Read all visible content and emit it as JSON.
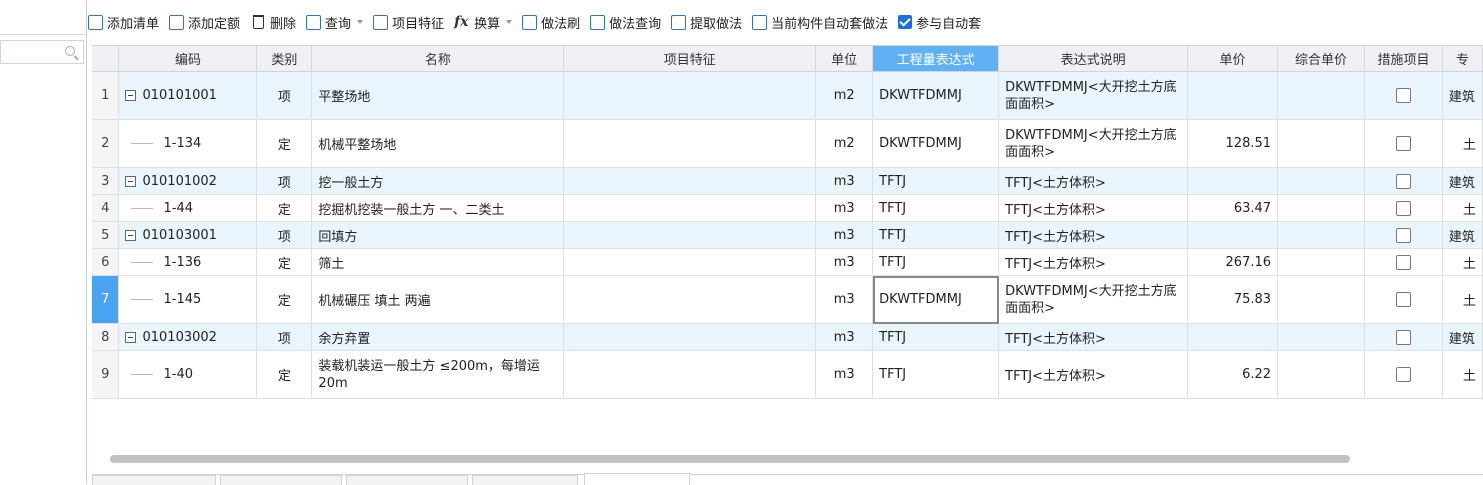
{
  "toolbar": {
    "add_list": "添加清单",
    "add_quota": "添加定额",
    "delete": "删除",
    "query": "查询",
    "item_feature": "项目特征",
    "convert": "换算",
    "method_brush": "做法刷",
    "method_query": "做法查询",
    "extract_method": "提取做法",
    "auto_apply": "当前构件自动套做法",
    "participate_auto": "参与自动套"
  },
  "columns": [
    "编码",
    "类别",
    "名称",
    "项目特征",
    "单位",
    "工程量表达式",
    "表达式说明",
    "单价",
    "综合单价",
    "措施项目",
    "专"
  ],
  "rows": [
    {
      "num": "1",
      "code": "010101001",
      "type": "项",
      "name": "平整场地",
      "feature": "",
      "unit": "m2",
      "expr": "DKWTFDMMJ",
      "desc": "DKWTFDMMJ<大开挖土方底面面积>",
      "price": "",
      "comp": "",
      "major": "建筑"
    },
    {
      "num": "2",
      "code": "1-134",
      "type": "定",
      "name": "机械平整场地",
      "feature": "",
      "unit": "m2",
      "expr": "DKWTFDMMJ",
      "desc": "DKWTFDMMJ<大开挖土方底面面积>",
      "price": "128.51",
      "comp": "",
      "major": "土"
    },
    {
      "num": "3",
      "code": "010101002",
      "type": "项",
      "name": "挖一般土方",
      "feature": "",
      "unit": "m3",
      "expr": "TFTJ",
      "desc": "TFTJ<土方体积>",
      "price": "",
      "comp": "",
      "major": "建筑"
    },
    {
      "num": "4",
      "code": "1-44",
      "type": "定",
      "name": "挖掘机挖装一般土方 一、二类土",
      "feature": "",
      "unit": "m3",
      "expr": "TFTJ",
      "desc": "TFTJ<土方体积>",
      "price": "63.47",
      "comp": "",
      "major": "土"
    },
    {
      "num": "5",
      "code": "010103001",
      "type": "项",
      "name": "回填方",
      "feature": "",
      "unit": "m3",
      "expr": "TFTJ",
      "desc": "TFTJ<土方体积>",
      "price": "",
      "comp": "",
      "major": "建筑"
    },
    {
      "num": "6",
      "code": "1-136",
      "type": "定",
      "name": "筛土",
      "feature": "",
      "unit": "m3",
      "expr": "TFTJ",
      "desc": "TFTJ<土方体积>",
      "price": "267.16",
      "comp": "",
      "major": "土"
    },
    {
      "num": "7",
      "code": "1-145",
      "type": "定",
      "name": "机械碾压 填土 两遍",
      "feature": "",
      "unit": "m3",
      "expr": "DKWTFDMMJ",
      "desc": "DKWTFDMMJ<大开挖土方底面面积>",
      "price": "75.83",
      "comp": "",
      "major": "土"
    },
    {
      "num": "8",
      "code": "010103002",
      "type": "项",
      "name": "余方弃置",
      "feature": "",
      "unit": "m3",
      "expr": "TFTJ",
      "desc": "TFTJ<土方体积>",
      "price": "",
      "comp": "",
      "major": "建筑"
    },
    {
      "num": "9",
      "code": "1-40",
      "type": "定",
      "name": "装载机装运一般土方 ≤200m，每增运20m",
      "feature": "",
      "unit": "m3",
      "expr": "TFTJ",
      "desc": "TFTJ<土方体积>",
      "price": "6.22",
      "comp": "",
      "major": "土"
    }
  ]
}
